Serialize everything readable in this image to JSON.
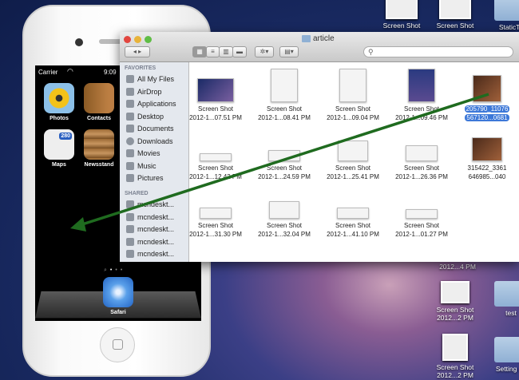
{
  "desktop": {
    "top_icons": [
      {
        "label": "Screen Shot"
      },
      {
        "label": "Screen Shot"
      },
      {
        "label": "StaticTa"
      }
    ],
    "right_icons": [
      {
        "line1": "",
        "line2": "2012...4 PM"
      },
      {
        "line1": "Screen Shot",
        "line2": "2012...2 PM"
      },
      {
        "line1": "test",
        "line2": ""
      },
      {
        "line1": "Screen Shot",
        "line2": "2012...2 PM"
      },
      {
        "line1": "Setting ap",
        "line2": ""
      }
    ]
  },
  "phone": {
    "carrier": "Carrier",
    "time": "9:09",
    "apps": [
      {
        "label": "Photos"
      },
      {
        "label": "Contacts"
      },
      {
        "label": "Maps"
      },
      {
        "label": "Newsstand"
      }
    ],
    "dock": [
      {
        "label": "Safari"
      }
    ],
    "maps_badge": "280"
  },
  "finder": {
    "title": "article",
    "search_placeholder": "",
    "favorites_header": "FAVORITES",
    "favorites": [
      "All My Files",
      "AirDrop",
      "Applications",
      "Desktop",
      "Documents",
      "Downloads",
      "Movies",
      "Music",
      "Pictures"
    ],
    "shared_header": "SHARED",
    "shared": [
      "mcndeskt...",
      "mcndeskt...",
      "mcndeskt...",
      "mcndeskt...",
      "mcndeskt..."
    ],
    "files": [
      [
        {
          "l1": "Screen Shot",
          "l2": "2012-1...07.51 PM"
        },
        {
          "l1": "Screen Shot",
          "l2": "2012-1...08.41 PM"
        },
        {
          "l1": "Screen Shot",
          "l2": "2012-1...09.04 PM"
        },
        {
          "l1": "Screen Shot",
          "l2": "2012-1...09.46 PM"
        },
        {
          "l1": "205790_11076",
          "l2": "567120...0681",
          "selected": true
        }
      ],
      [
        {
          "l1": "Screen Shot",
          "l2": "2012-1...12.42 PM"
        },
        {
          "l1": "Screen Shot",
          "l2": "2012-1...24.59 PM"
        },
        {
          "l1": "Screen Shot",
          "l2": "2012-1...25.41 PM"
        },
        {
          "l1": "Screen Shot",
          "l2": "2012-1...26.36 PM"
        },
        {
          "l1": "315422_3361",
          "l2": "646985...040"
        }
      ],
      [
        {
          "l1": "Screen Shot",
          "l2": "2012-1...31.30 PM"
        },
        {
          "l1": "Screen Shot",
          "l2": "2012-1...32.04 PM"
        },
        {
          "l1": "Screen Shot",
          "l2": "2012-1...41.10 PM"
        },
        {
          "l1": "Screen Shot",
          "l2": "2012-1...01.27 PM"
        }
      ]
    ]
  },
  "colors": {
    "arrow": "#1f6b1f",
    "selection": "#3d78d8"
  }
}
